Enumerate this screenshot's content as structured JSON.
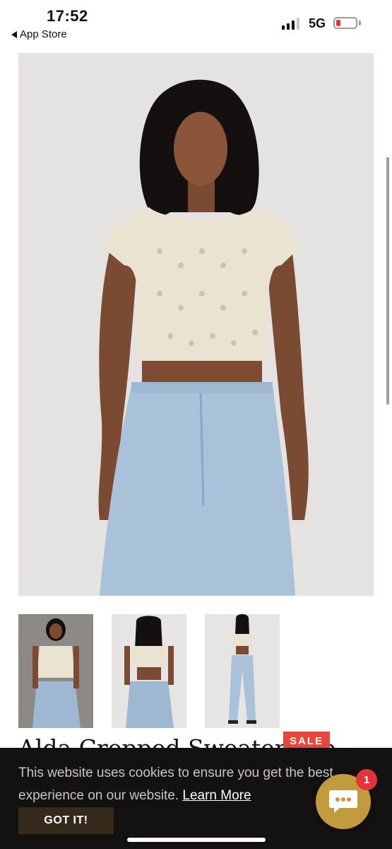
{
  "status_bar": {
    "time": "17:52",
    "back_label": "App Store",
    "network": "5G",
    "battery_level": 0.15,
    "battery_color": "#e8323c"
  },
  "product": {
    "main_image": {
      "alt": "Model wearing cream knit cropped sweater top and light blue jeans"
    },
    "thumbnails": [
      {
        "alt": "Front view"
      },
      {
        "alt": "Back view with open back"
      },
      {
        "alt": "Full length back view"
      }
    ],
    "title": "Alda Cropped Sweater Top",
    "sale_badge": "SALE",
    "sale_color": "#e8453c"
  },
  "cookie_banner": {
    "message": "This website uses cookies to ensure you get the best experience on our website.",
    "learn_more": "Learn More",
    "accept_label": "GOT IT!",
    "accent_color": "#34291b"
  },
  "chat": {
    "icon": "chat-bubble-icon",
    "badge_count": "1",
    "button_color": "#c29b3d"
  }
}
